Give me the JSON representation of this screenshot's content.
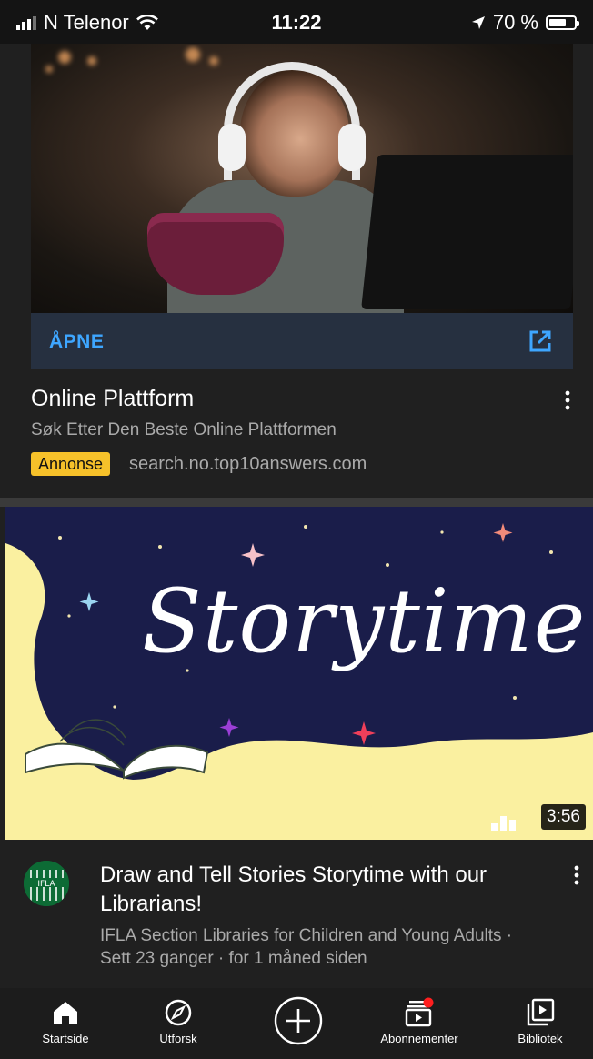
{
  "status_bar": {
    "carrier": "N Telenor",
    "time": "11:22",
    "battery_text": "70 %",
    "battery_level": 0.7
  },
  "ad": {
    "action_label": "ÅPNE",
    "title": "Online Plattform",
    "description": "Søk Etter Den Beste Online Plattformen",
    "badge": "Annonse",
    "url": "search.no.top10answers.com",
    "accent_color": "#3ea6ff",
    "badge_color": "#f6c12a"
  },
  "video": {
    "thumbnail_text": "Storytime",
    "duration": "3:56",
    "title": "Draw and Tell Stories  Storytime with our Librarians!",
    "meta": "IFLA Section Libraries for Children and Young Adults · Sett 23 ganger · for 1 måned siden",
    "channel_avatar_text": "IFLA"
  },
  "nav": {
    "items": [
      {
        "label": "Startside",
        "icon": "home-icon",
        "active": true
      },
      {
        "label": "Utforsk",
        "icon": "compass-icon"
      },
      {
        "label": "",
        "icon": "create-plus-icon"
      },
      {
        "label": "Abonnementer",
        "icon": "subscriptions-icon",
        "notification": true
      },
      {
        "label": "Bibliotek",
        "icon": "library-icon"
      }
    ]
  }
}
